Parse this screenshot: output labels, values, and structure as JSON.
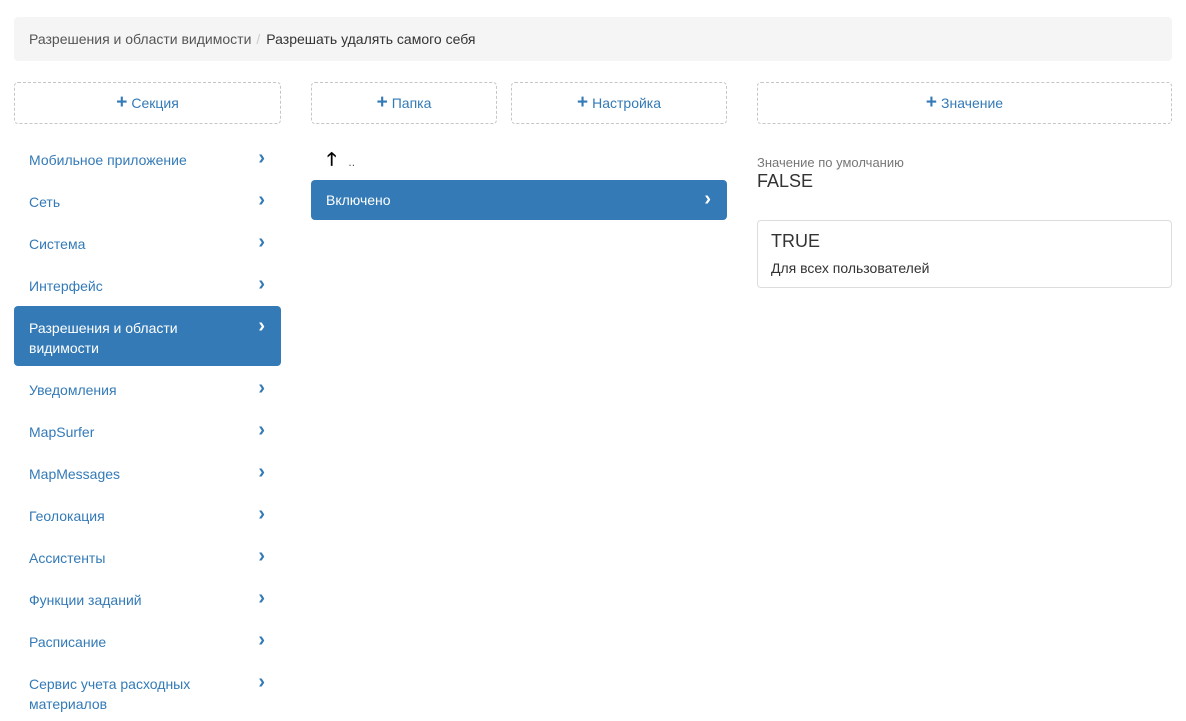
{
  "breadcrumb": {
    "parent": "Разрешения и области видимости",
    "separator": "/",
    "current": "Разрешать удалять самого себя"
  },
  "toolbar": {
    "add_section": "Секция",
    "add_folder": "Папка",
    "add_setting": "Настройка",
    "add_value": "Значение",
    "plus_icon": "+"
  },
  "sections": [
    "Мобильное приложение",
    "Сеть",
    "Система",
    "Интерфейс",
    "Разрешения и области видимости",
    "Уведомления",
    "MapSurfer",
    "MapMessages",
    "Геолокация",
    "Ассистенты",
    "Функции заданий",
    "Расписание",
    "Сервис учета расходных материалов"
  ],
  "chevron_icon": "›",
  "folders": {
    "up_icon": "🡑",
    "up_label": "..",
    "items": [
      "Включено"
    ]
  },
  "values": {
    "default_label": "Значение по умолчанию",
    "default_value": "FALSE",
    "cards": [
      {
        "value": "TRUE",
        "scope": "Для всех пользователей"
      }
    ]
  },
  "colors": {
    "accent": "#337ab7",
    "breadcrumb_bg": "#f5f5f5"
  }
}
